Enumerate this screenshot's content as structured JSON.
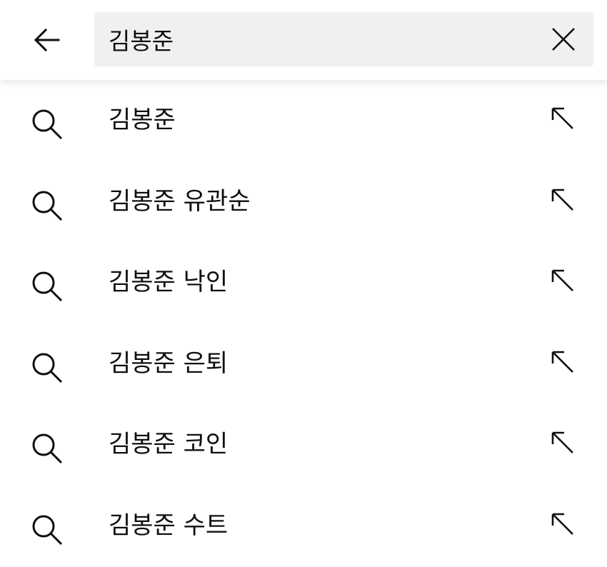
{
  "search": {
    "query": "김봉준",
    "back_icon": "arrow-left-icon",
    "clear_icon": "close-icon"
  },
  "suggestions": [
    {
      "text": "김봉준",
      "icon": "search-icon",
      "action_icon": "arrow-up-left-icon"
    },
    {
      "text": "김봉준 유관순",
      "icon": "search-icon",
      "action_icon": "arrow-up-left-icon"
    },
    {
      "text": "김봉준 낙인",
      "icon": "search-icon",
      "action_icon": "arrow-up-left-icon"
    },
    {
      "text": "김봉준 은퇴",
      "icon": "search-icon",
      "action_icon": "arrow-up-left-icon"
    },
    {
      "text": "김봉준 코인",
      "icon": "search-icon",
      "action_icon": "arrow-up-left-icon"
    },
    {
      "text": "김봉준 수트",
      "icon": "search-icon",
      "action_icon": "arrow-up-left-icon"
    }
  ]
}
